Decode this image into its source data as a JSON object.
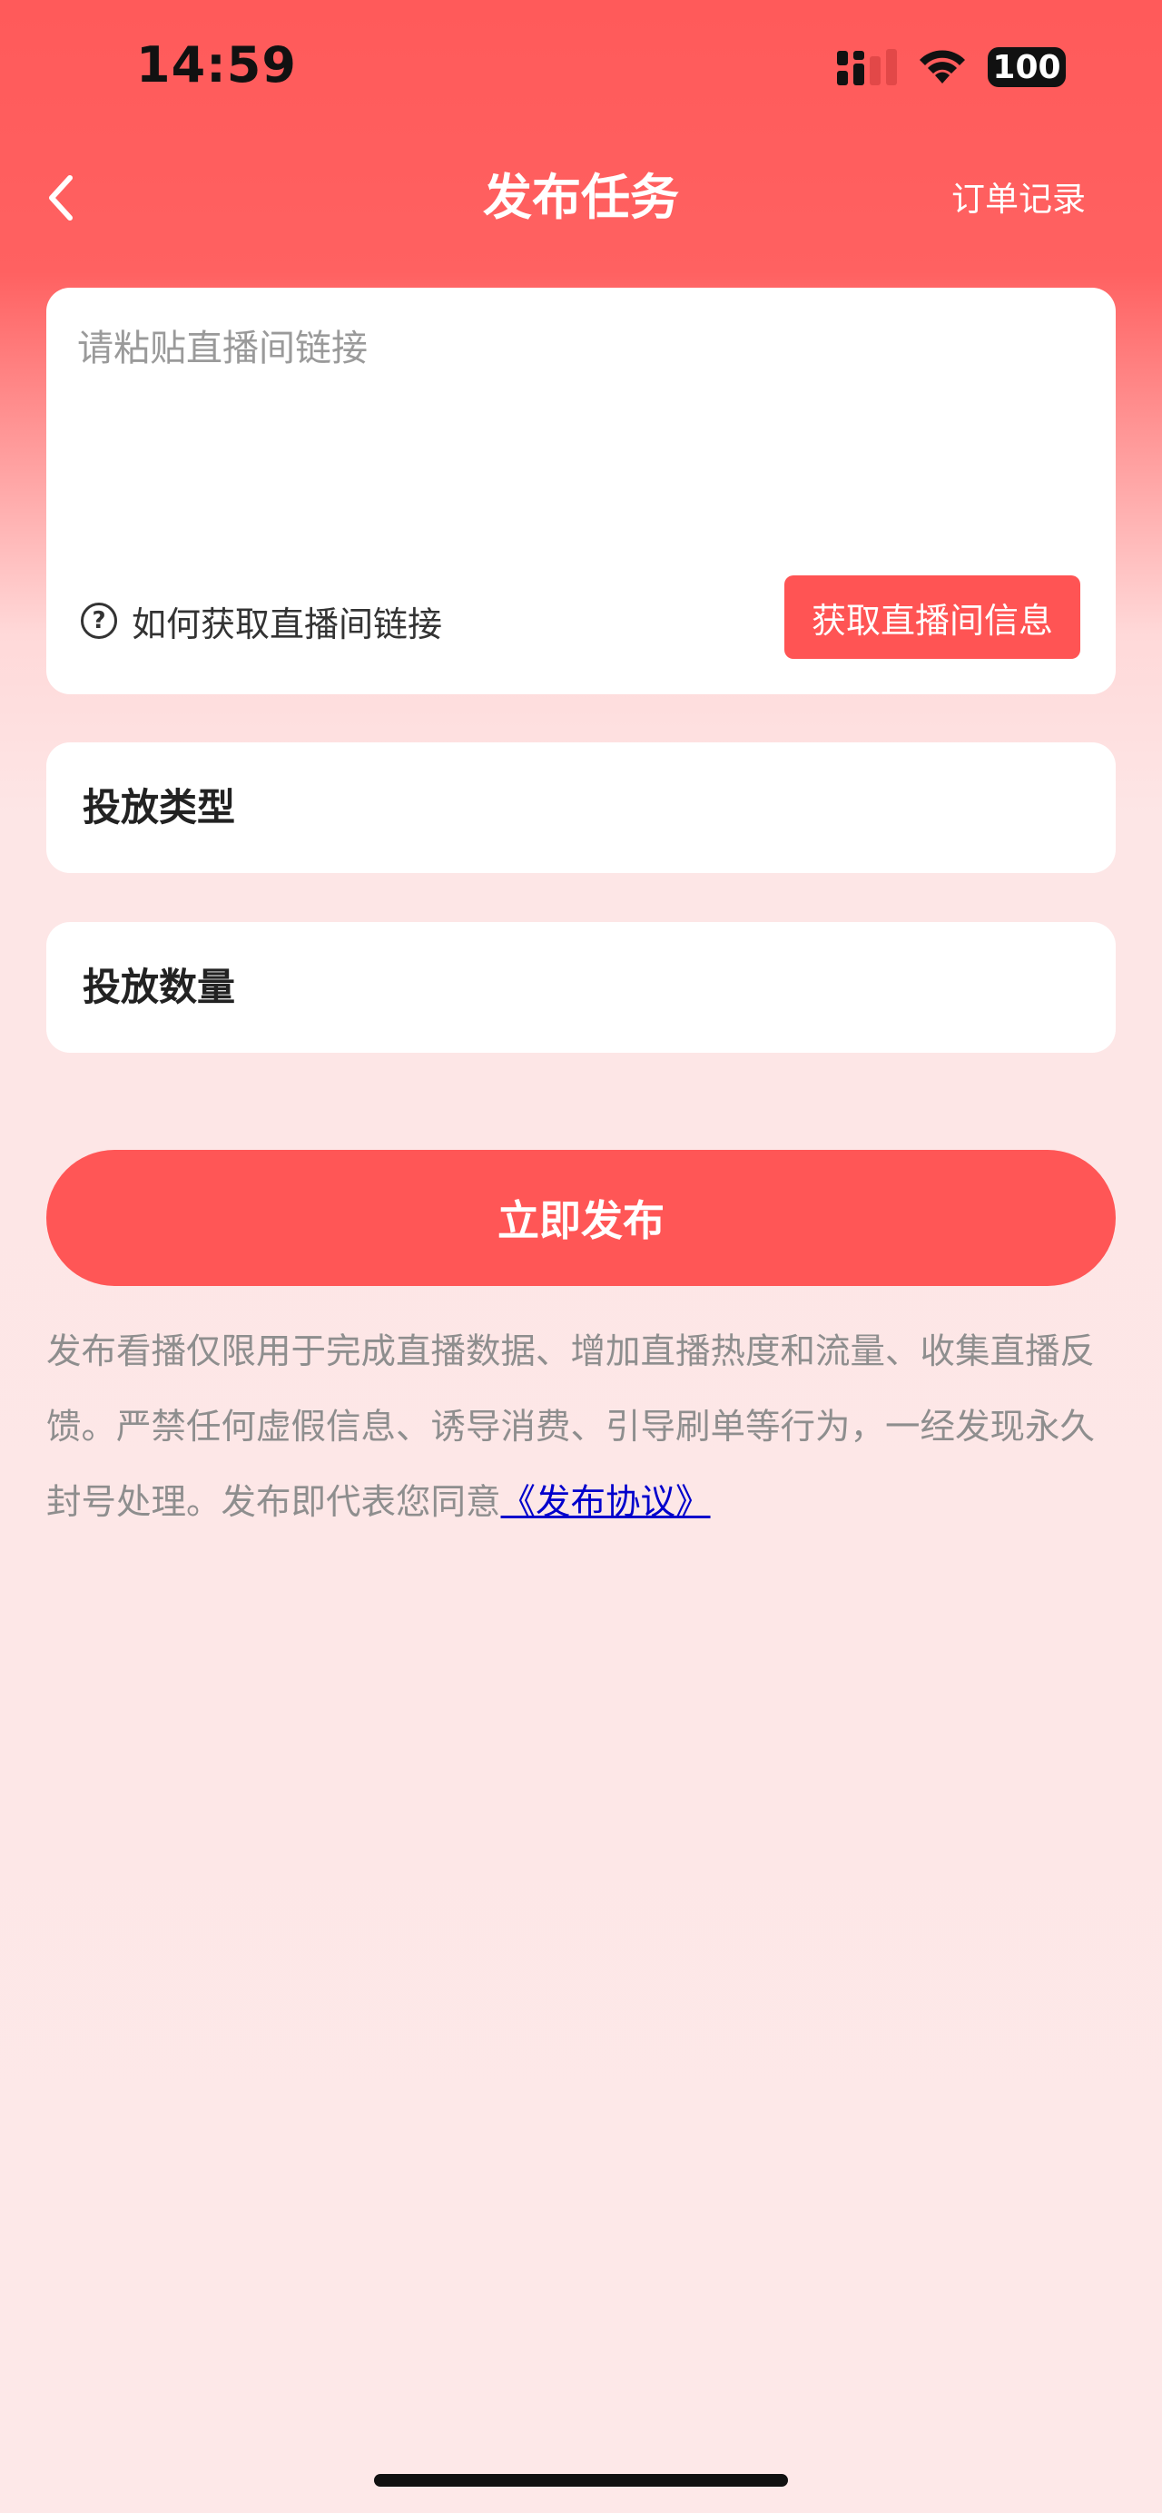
{
  "status_bar": {
    "time": "14:59",
    "battery": "100",
    "icons": [
      "signal-icon",
      "wifi-icon",
      "battery-icon"
    ]
  },
  "nav": {
    "back_icon": "chevron-left-icon",
    "title": "发布任务",
    "right_label": "订单记录"
  },
  "link_card": {
    "placeholder": "请粘贴直播间链接",
    "value": "",
    "help_icon": "question-circle-icon",
    "help_text": "如何获取直播间链接",
    "help_glyph": "?",
    "fetch_button": "获取直播间信息"
  },
  "type_card": {
    "label": "投放类型"
  },
  "qty_card": {
    "label": "投放数量"
  },
  "publish_button": "立即发布",
  "notice": {
    "text": "发布看播仅限用于完成直播数据、增加直播热度和流量、收集直播反馈。严禁任何虚假信息、诱导消费、引导刷单等行为，一经发现永久封号处理。发布即代表您同意",
    "agreement_link": "《发布协议》"
  },
  "colors": {
    "accent": "#ff5656",
    "header_red": "#ff5a5a",
    "page_bg": "#fde8e8",
    "link": "#0000cc"
  }
}
